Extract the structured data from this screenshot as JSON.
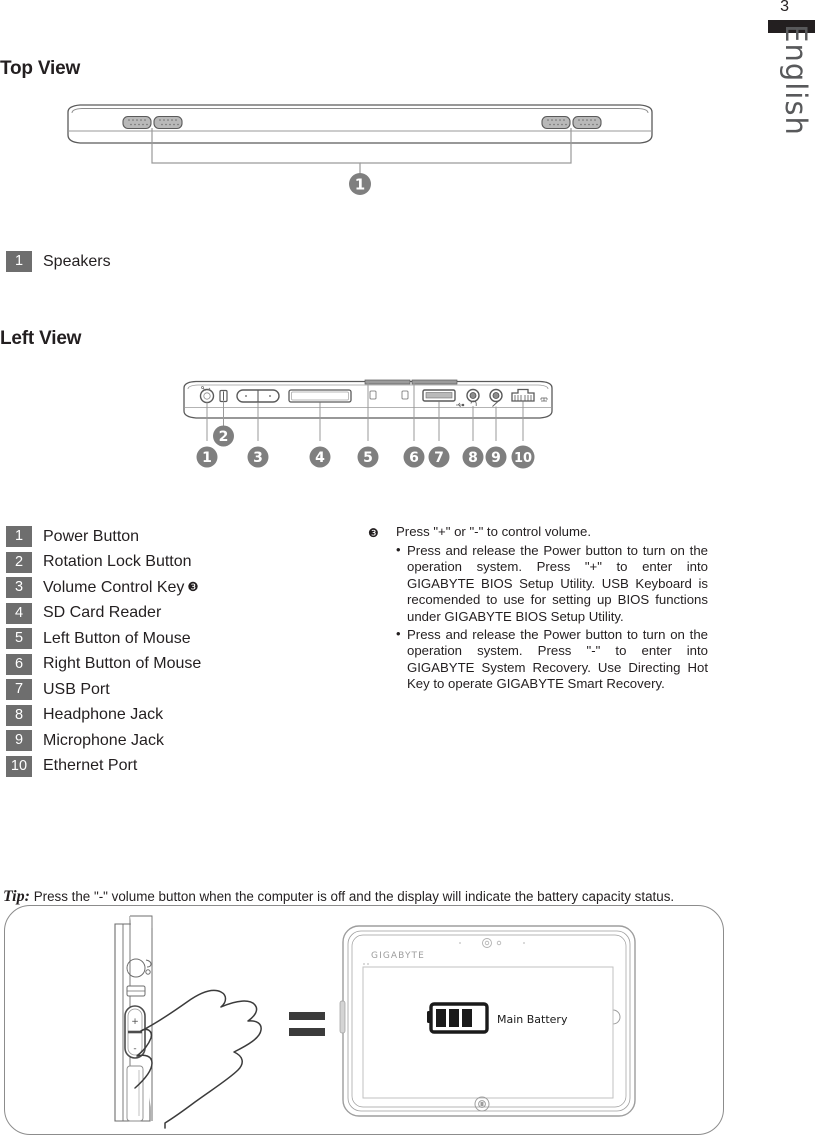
{
  "page": {
    "number": "3",
    "language_tab": "English"
  },
  "sections": {
    "top_view": {
      "heading": "Top View",
      "callouts": [
        "1"
      ],
      "legend": [
        {
          "num": "1",
          "label": "Speakers"
        }
      ]
    },
    "left_view": {
      "heading": "Left View",
      "callouts": [
        "1",
        "2",
        "3",
        "4",
        "5",
        "6",
        "7",
        "8",
        "9",
        "10"
      ],
      "legend": [
        {
          "num": "1",
          "label": "Power Button"
        },
        {
          "num": "2",
          "label": "Rotation Lock Button"
        },
        {
          "num": "3",
          "label": "Volume Control Key",
          "footnote": "❸"
        },
        {
          "num": "4",
          "label": "SD Card Reader"
        },
        {
          "num": "5",
          "label": "Left Button of Mouse"
        },
        {
          "num": "6",
          "label": "Right Button of Mouse"
        },
        {
          "num": "7",
          "label": "USB Port"
        },
        {
          "num": "8",
          "label": "Headphone Jack"
        },
        {
          "num": "9",
          "label": "Microphone Jack"
        },
        {
          "num": "10",
          "label": "Ethernet Port"
        }
      ]
    }
  },
  "note": {
    "mark": "❸",
    "headline": "Press \"+\" or \"-\" to control volume.",
    "bullets": [
      "Press and release the Power button to turn on the operation system. Press \"+\" to enter into GIGABYTE BIOS Setup Utility. USB Keyboard is recomended to  use for setting up BIOS functions under GIGABYTE BIOS Setup Utility.",
      "Press and release the Power button to  turn on the operation system. Press \"-\" to enter into GIGABYTE System Recovery. Use Directing Hot Key to operate GIGABYTE Smart Recovery."
    ]
  },
  "tip": {
    "label": "Tip:",
    "text": "Press the \"-\" volume button when the computer is off and the display will indicate the battery capacity status."
  },
  "illustration": {
    "volume_plus": "+",
    "volume_minus": "-",
    "equals": "=",
    "tablet_brand": "GIGABYTE",
    "battery_label": "Main Battery"
  },
  "colors": {
    "callout_badge": "#7f7f7f",
    "legend_box": "#6e6e6e",
    "text": "#231f20",
    "lang_tab_text": "#58595b",
    "lang_bar": "#231f20",
    "line": "#595959"
  }
}
